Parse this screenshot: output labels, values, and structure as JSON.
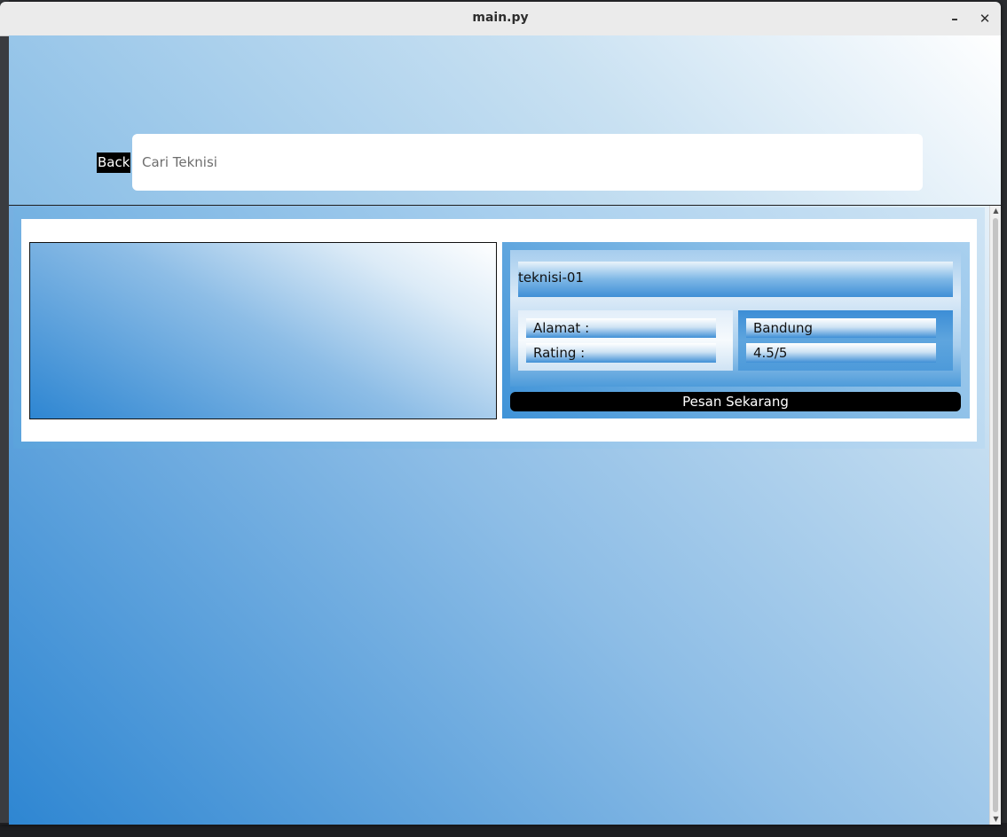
{
  "window": {
    "title": "main.py",
    "minimize_glyph": "–",
    "close_glyph": "✕"
  },
  "header": {
    "back_label": "Back",
    "search": {
      "placeholder": "Cari Teknisi",
      "value": ""
    }
  },
  "results": [
    {
      "name": "teknisi-01",
      "address_label": "Alamat :",
      "address_value": "Bandung",
      "rating_label": "Rating :",
      "rating_value": "4.5/5",
      "order_label": "Pesan Sekarang"
    }
  ],
  "colors": {
    "accent_blue": "#2e86d2",
    "light_blue": "#c2dcf0",
    "button_black": "#000000"
  }
}
